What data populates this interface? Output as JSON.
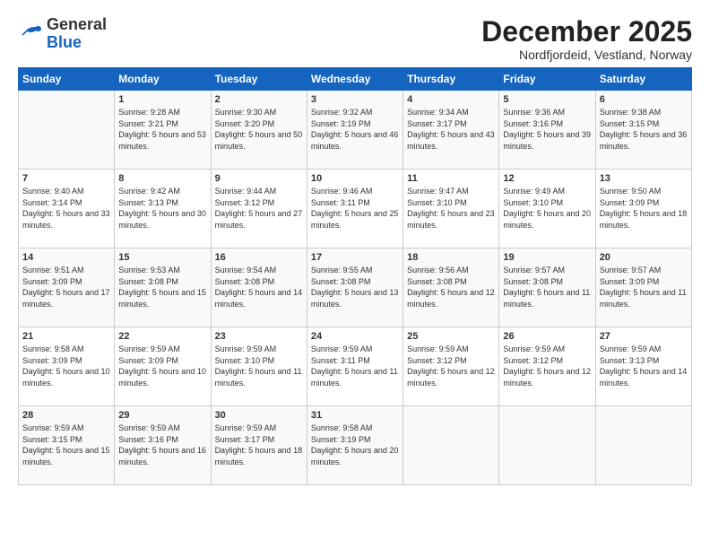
{
  "header": {
    "logo_general": "General",
    "logo_blue": "Blue",
    "month_title": "December 2025",
    "location": "Nordfjordeid, Vestland, Norway"
  },
  "weekdays": [
    "Sunday",
    "Monday",
    "Tuesday",
    "Wednesday",
    "Thursday",
    "Friday",
    "Saturday"
  ],
  "weeks": [
    [
      {
        "day": "",
        "sunrise": "",
        "sunset": "",
        "daylight": ""
      },
      {
        "day": "1",
        "sunrise": "9:28 AM",
        "sunset": "3:21 PM",
        "daylight": "5 hours and 53 minutes."
      },
      {
        "day": "2",
        "sunrise": "9:30 AM",
        "sunset": "3:20 PM",
        "daylight": "5 hours and 50 minutes."
      },
      {
        "day": "3",
        "sunrise": "9:32 AM",
        "sunset": "3:19 PM",
        "daylight": "5 hours and 46 minutes."
      },
      {
        "day": "4",
        "sunrise": "9:34 AM",
        "sunset": "3:17 PM",
        "daylight": "5 hours and 43 minutes."
      },
      {
        "day": "5",
        "sunrise": "9:36 AM",
        "sunset": "3:16 PM",
        "daylight": "5 hours and 39 minutes."
      },
      {
        "day": "6",
        "sunrise": "9:38 AM",
        "sunset": "3:15 PM",
        "daylight": "5 hours and 36 minutes."
      }
    ],
    [
      {
        "day": "7",
        "sunrise": "9:40 AM",
        "sunset": "3:14 PM",
        "daylight": "5 hours and 33 minutes."
      },
      {
        "day": "8",
        "sunrise": "9:42 AM",
        "sunset": "3:13 PM",
        "daylight": "5 hours and 30 minutes."
      },
      {
        "day": "9",
        "sunrise": "9:44 AM",
        "sunset": "3:12 PM",
        "daylight": "5 hours and 27 minutes."
      },
      {
        "day": "10",
        "sunrise": "9:46 AM",
        "sunset": "3:11 PM",
        "daylight": "5 hours and 25 minutes."
      },
      {
        "day": "11",
        "sunrise": "9:47 AM",
        "sunset": "3:10 PM",
        "daylight": "5 hours and 23 minutes."
      },
      {
        "day": "12",
        "sunrise": "9:49 AM",
        "sunset": "3:10 PM",
        "daylight": "5 hours and 20 minutes."
      },
      {
        "day": "13",
        "sunrise": "9:50 AM",
        "sunset": "3:09 PM",
        "daylight": "5 hours and 18 minutes."
      }
    ],
    [
      {
        "day": "14",
        "sunrise": "9:51 AM",
        "sunset": "3:09 PM",
        "daylight": "5 hours and 17 minutes."
      },
      {
        "day": "15",
        "sunrise": "9:53 AM",
        "sunset": "3:08 PM",
        "daylight": "5 hours and 15 minutes."
      },
      {
        "day": "16",
        "sunrise": "9:54 AM",
        "sunset": "3:08 PM",
        "daylight": "5 hours and 14 minutes."
      },
      {
        "day": "17",
        "sunrise": "9:55 AM",
        "sunset": "3:08 PM",
        "daylight": "5 hours and 13 minutes."
      },
      {
        "day": "18",
        "sunrise": "9:56 AM",
        "sunset": "3:08 PM",
        "daylight": "5 hours and 12 minutes."
      },
      {
        "day": "19",
        "sunrise": "9:57 AM",
        "sunset": "3:08 PM",
        "daylight": "5 hours and 11 minutes."
      },
      {
        "day": "20",
        "sunrise": "9:57 AM",
        "sunset": "3:09 PM",
        "daylight": "5 hours and 11 minutes."
      }
    ],
    [
      {
        "day": "21",
        "sunrise": "9:58 AM",
        "sunset": "3:09 PM",
        "daylight": "5 hours and 10 minutes."
      },
      {
        "day": "22",
        "sunrise": "9:59 AM",
        "sunset": "3:09 PM",
        "daylight": "5 hours and 10 minutes."
      },
      {
        "day": "23",
        "sunrise": "9:59 AM",
        "sunset": "3:10 PM",
        "daylight": "5 hours and 11 minutes."
      },
      {
        "day": "24",
        "sunrise": "9:59 AM",
        "sunset": "3:11 PM",
        "daylight": "5 hours and 11 minutes."
      },
      {
        "day": "25",
        "sunrise": "9:59 AM",
        "sunset": "3:12 PM",
        "daylight": "5 hours and 12 minutes."
      },
      {
        "day": "26",
        "sunrise": "9:59 AM",
        "sunset": "3:12 PM",
        "daylight": "5 hours and 12 minutes."
      },
      {
        "day": "27",
        "sunrise": "9:59 AM",
        "sunset": "3:13 PM",
        "daylight": "5 hours and 14 minutes."
      }
    ],
    [
      {
        "day": "28",
        "sunrise": "9:59 AM",
        "sunset": "3:15 PM",
        "daylight": "5 hours and 15 minutes."
      },
      {
        "day": "29",
        "sunrise": "9:59 AM",
        "sunset": "3:16 PM",
        "daylight": "5 hours and 16 minutes."
      },
      {
        "day": "30",
        "sunrise": "9:59 AM",
        "sunset": "3:17 PM",
        "daylight": "5 hours and 18 minutes."
      },
      {
        "day": "31",
        "sunrise": "9:58 AM",
        "sunset": "3:19 PM",
        "daylight": "5 hours and 20 minutes."
      },
      {
        "day": "",
        "sunrise": "",
        "sunset": "",
        "daylight": ""
      },
      {
        "day": "",
        "sunrise": "",
        "sunset": "",
        "daylight": ""
      },
      {
        "day": "",
        "sunrise": "",
        "sunset": "",
        "daylight": ""
      }
    ]
  ]
}
